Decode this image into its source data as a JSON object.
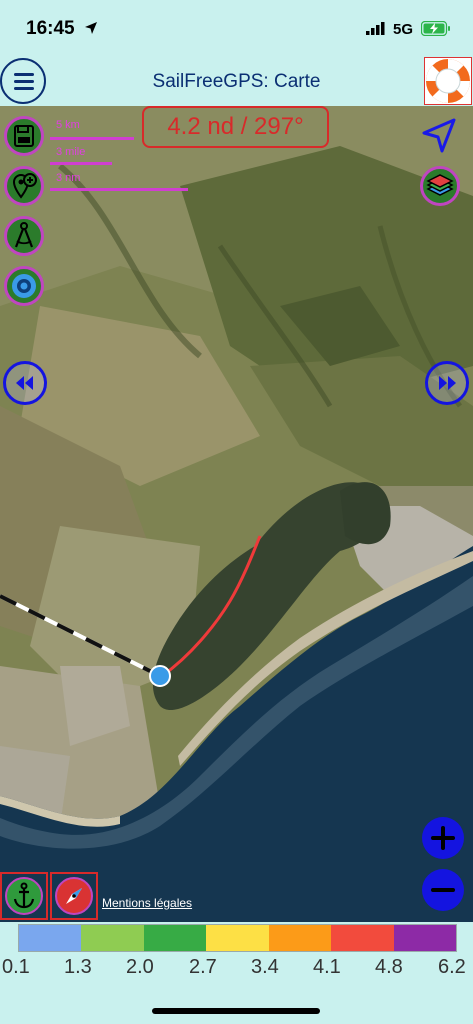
{
  "status_bar": {
    "time": "16:45",
    "network": "5G"
  },
  "header": {
    "title": "SailFreeGPS: Carte"
  },
  "map": {
    "speed_heading": "4.2 nd / 297°",
    "scale_labels": [
      "5 km",
      "3 mile",
      "3 nm"
    ],
    "legal_link": "Mentions légales"
  },
  "legend": {
    "colors": [
      "#7aa7ee",
      "#8fcc52",
      "#37ab45",
      "#fde045",
      "#fc9b18",
      "#f24b3d",
      "#8d2aa6"
    ],
    "labels": [
      "0.1",
      "1.3",
      "2.0",
      "2.7",
      "3.4",
      "4.1",
      "4.8",
      "6.2"
    ]
  },
  "icons": {
    "menu": "hamburger-menu-icon",
    "lifebuoy": "lifebuoy-icon",
    "save": "save-disk-icon",
    "add_waypoint": "add-waypoint-icon",
    "compass_divider": "drafting-compass-icon",
    "target": "target-eye-icon",
    "location": "location-arrow-icon",
    "layers": "layers-icon",
    "rewind": "rewind-icon",
    "fast_forward": "fast-forward-icon",
    "zoom_in": "zoom-in-icon",
    "zoom_out": "zoom-out-icon",
    "anchor": "anchor-icon",
    "compass": "compass-icon"
  }
}
